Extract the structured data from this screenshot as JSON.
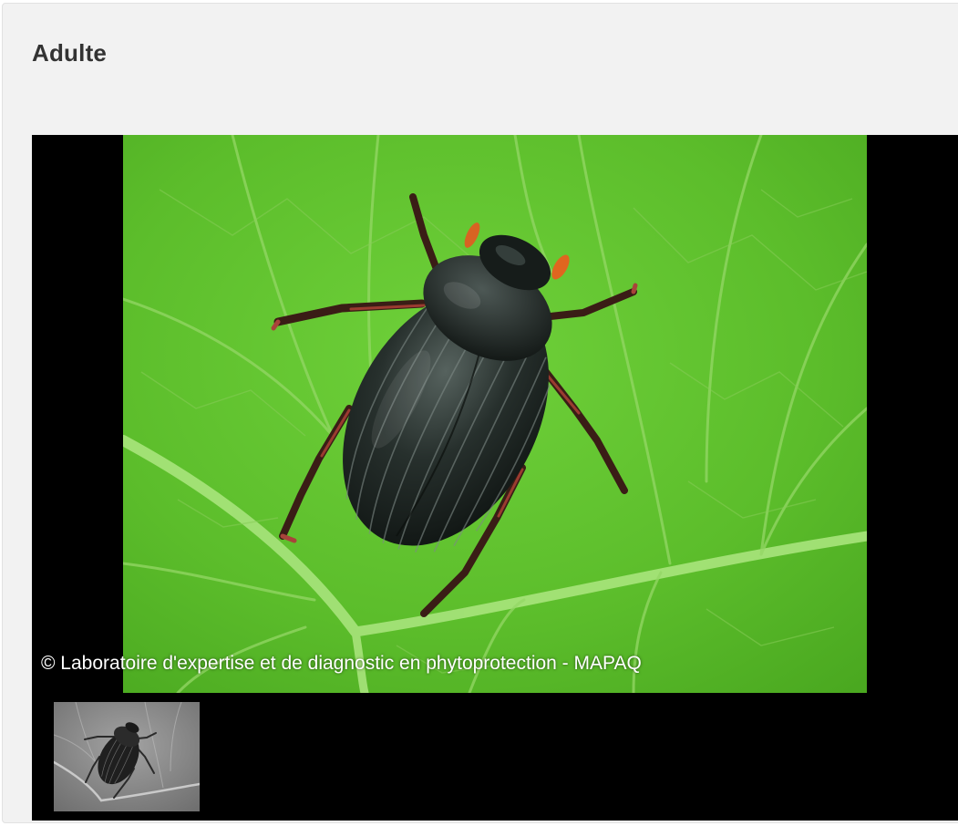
{
  "section": {
    "title": "Adulte"
  },
  "gallery": {
    "main_image_alt": "Adulte",
    "caption": "© Laboratoire d'expertise et de diagnostic en phytoprotection - MAPAQ",
    "thumbnails": [
      {
        "alt": "Adulte",
        "selected": true
      }
    ],
    "colors": {
      "leaf": "#5fbf2c",
      "leaf_vein": "#a6e27a",
      "beetle": "#1c2421",
      "backdrop": "#000000",
      "panel": "#f2f2f2"
    }
  }
}
